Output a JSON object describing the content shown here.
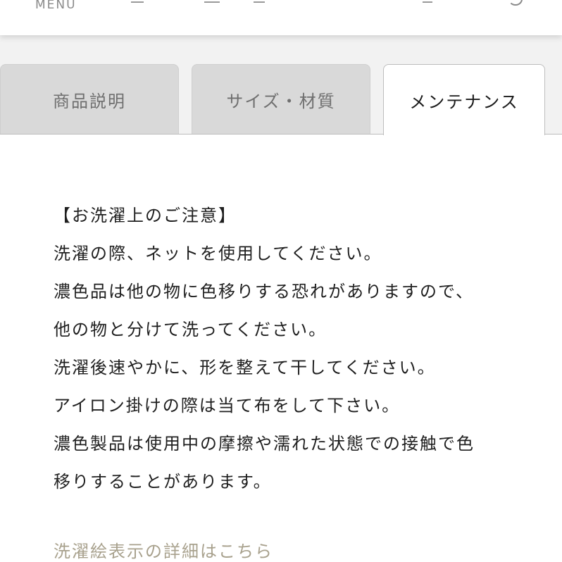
{
  "header": {
    "menu_label": "MENU"
  },
  "tabs": [
    {
      "label": "商品説明",
      "active": false
    },
    {
      "label": "サイズ・材質",
      "active": false
    },
    {
      "label": "メンテナンス",
      "active": true
    }
  ],
  "maintenance": {
    "lines": [
      "【お洗濯上のご注意】",
      "洗濯の際、ネットを使用してください。",
      "濃色品は他の物に色移りする恐れがありますので、",
      "他の物と分けて洗ってください。",
      "洗濯後速やかに、形を整えて干してください。",
      "アイロン掛けの際は当て布をして下さい。",
      "濃色製品は使用中の摩擦や濡れた状態での接触で色",
      "移りすることがあります。"
    ],
    "link_label": "洗濯絵表示の詳細はこちら"
  },
  "colors": {
    "tab_inactive_bg": "#d9d9d9",
    "tab_inactive_text": "#6f6f6f",
    "tab_active_text": "#1a1a1a",
    "body_text": "#1f1f1f",
    "link_text": "#a8a18d"
  }
}
